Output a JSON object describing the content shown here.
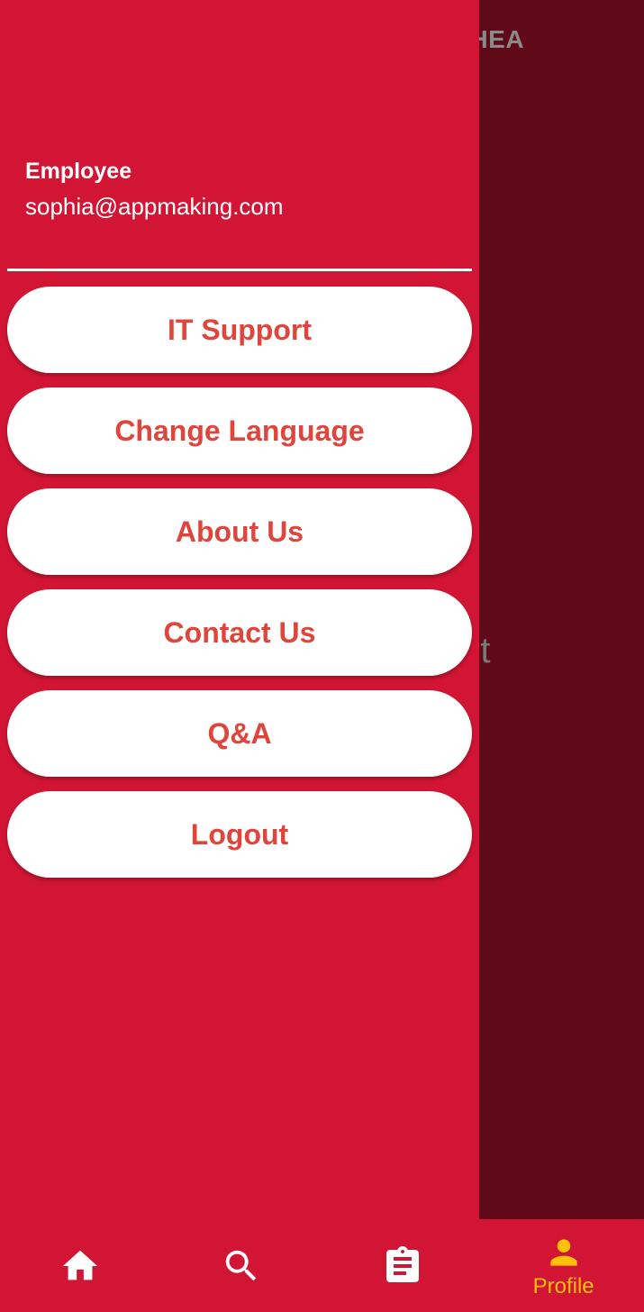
{
  "background_screen": {
    "title_fragment": "OPHEA",
    "button_fragment": "Out"
  },
  "drawer": {
    "header": {
      "role": "Employee",
      "email": "sophia@appmaking.com"
    },
    "menu_items": [
      {
        "label": "IT Support"
      },
      {
        "label": "Change Language"
      },
      {
        "label": "About Us"
      },
      {
        "label": "Contact Us"
      },
      {
        "label": "Q&A"
      },
      {
        "label": "Logout"
      }
    ]
  },
  "bottom_nav": {
    "items": [
      {
        "icon": "home-icon",
        "label": ""
      },
      {
        "icon": "search-icon",
        "label": ""
      },
      {
        "icon": "clipboard-icon",
        "label": ""
      },
      {
        "icon": "person-icon",
        "label": "Profile",
        "active": true
      }
    ]
  },
  "colors": {
    "primary": "#d31535",
    "scrim_dark": "#5f0919",
    "button_text": "#e0453c",
    "active_nav": "#ffc107",
    "white": "#ffffff"
  }
}
